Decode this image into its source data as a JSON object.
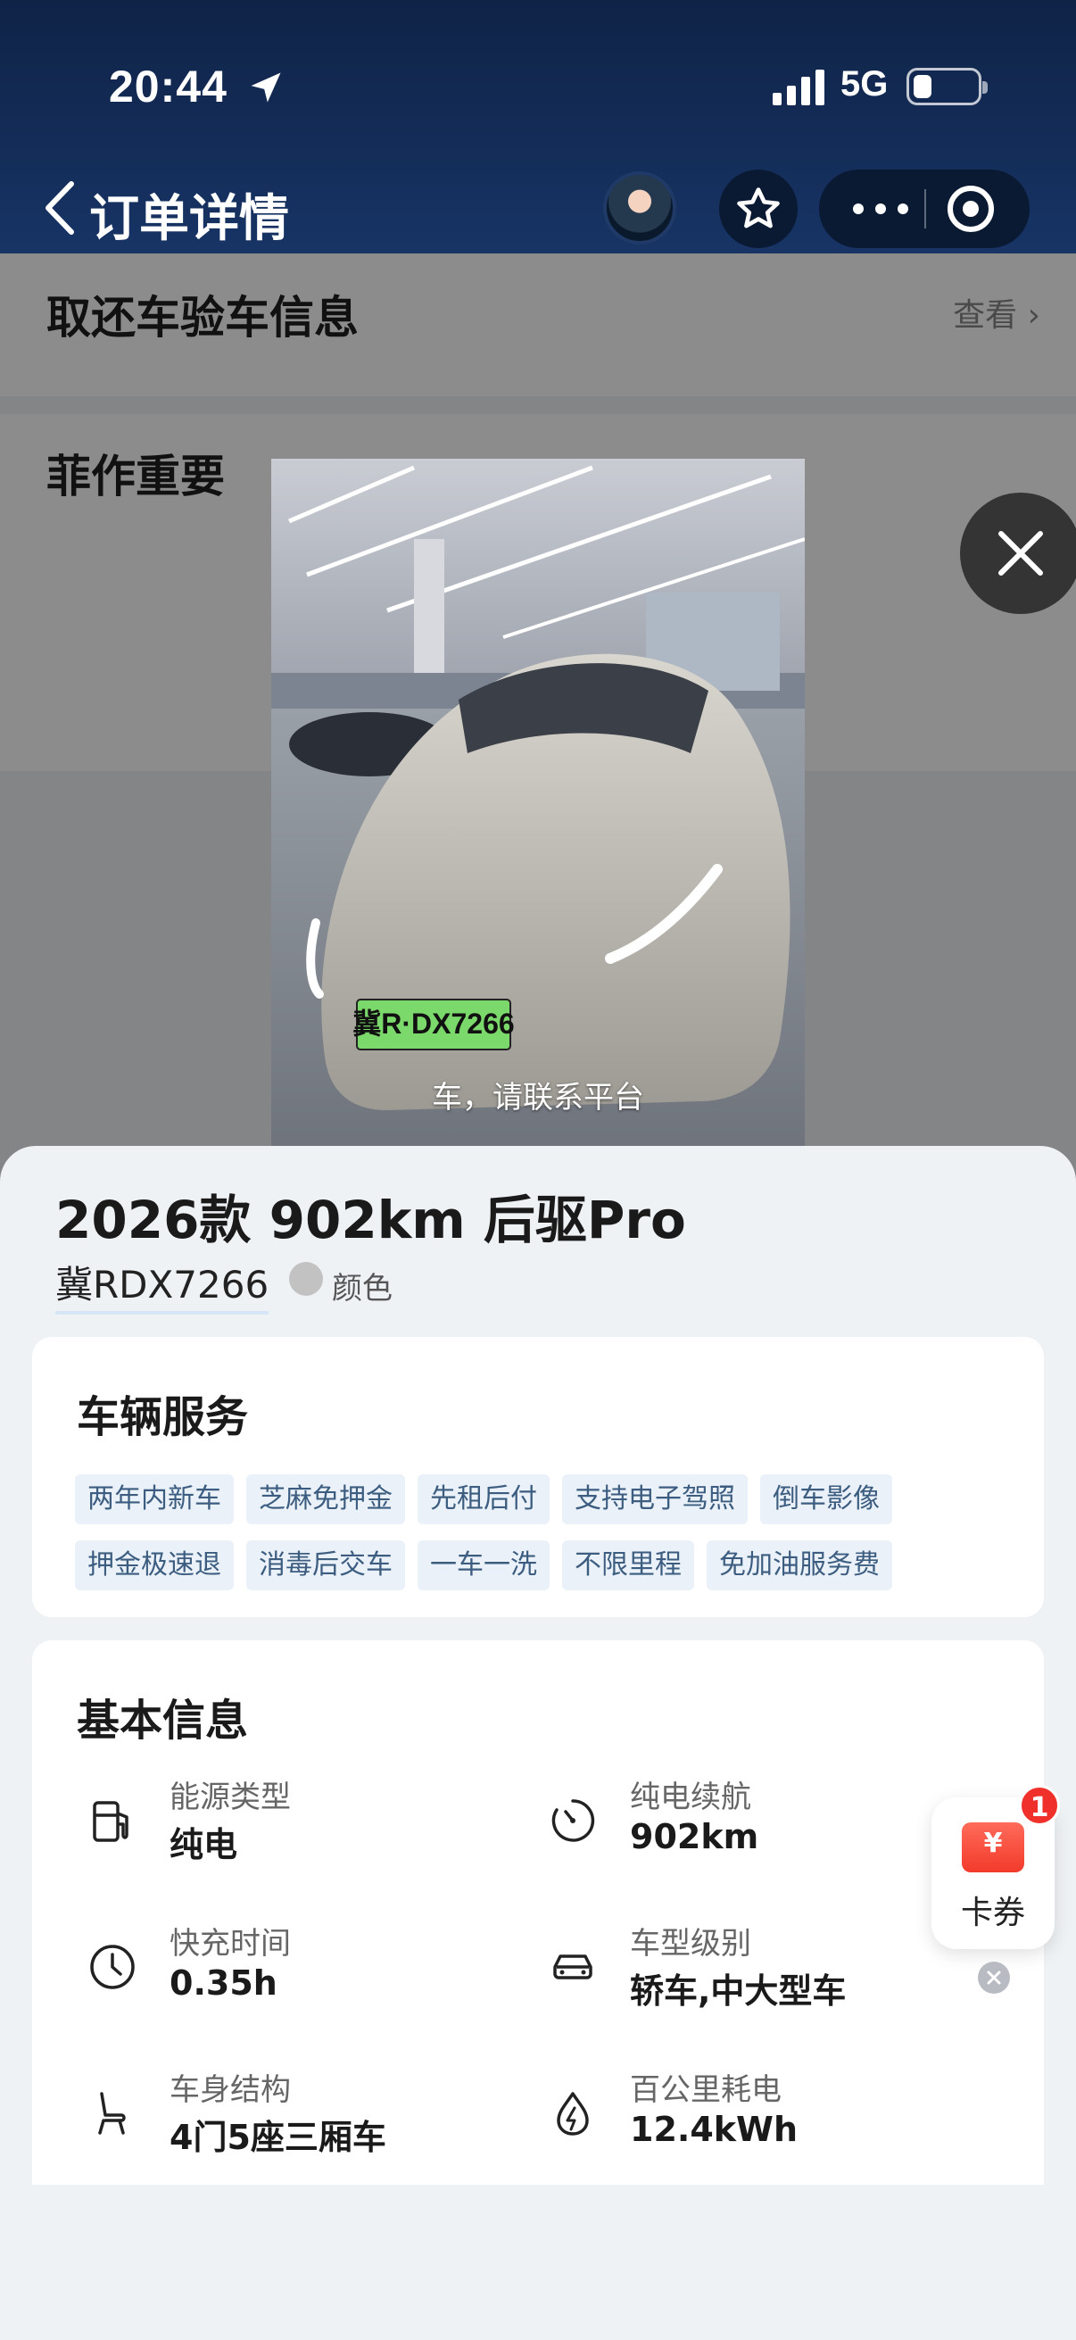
{
  "status_bar": {
    "time": "20:44",
    "network": "5G"
  },
  "nav": {
    "title": "订单详情"
  },
  "background_page": {
    "section1_title": "取还车验车信息",
    "section1_link": "查看 ›",
    "section2_title": "菲作重要"
  },
  "photo": {
    "plate_text": "冀R·DX7266",
    "caption": "车，请联系平台"
  },
  "vehicle": {
    "model": "2026款 902km 后驱Pro",
    "plate": "冀RDX7266",
    "color_label": "颜色"
  },
  "services": {
    "title": "车辆服务",
    "tags_row1": [
      "两年内新车",
      "芝麻免押金",
      "先租后付",
      "支持电子驾照",
      "倒车影像"
    ],
    "tags_row2": [
      "押金极速退",
      "消毒后交车",
      "一车一洗",
      "不限里程",
      "免加油服务费"
    ]
  },
  "basic_info": {
    "title": "基本信息",
    "items": [
      {
        "label": "能源类型",
        "value": "纯电",
        "icon": "fuel-pump-icon"
      },
      {
        "label": "纯电续航",
        "value": "902km",
        "icon": "gauge-icon"
      },
      {
        "label": "快充时间",
        "value": "0.35h",
        "icon": "clock-icon"
      },
      {
        "label": "车型级别",
        "value": "轿车,中大型车",
        "icon": "car-icon"
      },
      {
        "label": "车身结构",
        "value": "4门5座三厢车",
        "icon": "seat-icon"
      },
      {
        "label": "百公里耗电",
        "value": "12.4kWh",
        "icon": "electric-drop-icon"
      }
    ]
  },
  "coupon": {
    "label": "卡券",
    "badge": "1",
    "symbol": "¥"
  }
}
